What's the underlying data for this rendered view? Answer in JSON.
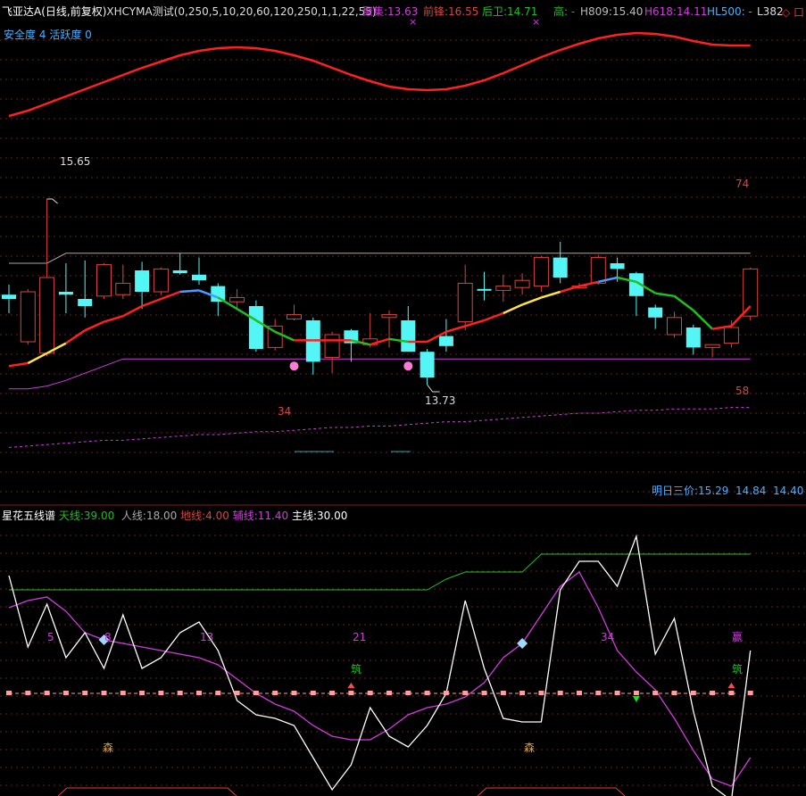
{
  "colors": {
    "background": "#000000",
    "up": "#e0413a",
    "down": "#54f5f5",
    "ma_red": "#ff2020",
    "ma_green": "#1fbf1f",
    "ma_yellow": "#ffe24a",
    "ma_blue": "#4a9cff",
    "magenta": "#d33be0",
    "upper_band": "#a8a8a8",
    "grid": "#6b1f1f",
    "divider": "#8a1a1a",
    "white_line": "#ffffff",
    "tian_line": "#1fbf1f",
    "pink": "#ff9f9f",
    "blue_title": "#4ab0ff"
  },
  "header": {
    "instrument": "飞亚达A(日线,前复权)",
    "indicator": "XHCYMA测试(0,250,5,10,20,60,120,250,1,1,22,55)",
    "juji_label": "聚集:",
    "juji_value": "13.63",
    "qianfeng_label": "前锋:",
    "qianfeng_value": "16.55",
    "houwei_label": "后卫:",
    "houwei_value": "14.71",
    "gao_label": "高: -",
    "h809_label": "H809:",
    "h809_value": "15.40",
    "h618_label": "H618:",
    "h618_value": "14.11",
    "hl500_label": "HL500: -",
    "l382_label": "L382",
    "marker": "×",
    "icons": "◇ 口"
  },
  "safety": {
    "anquan_label": "安全度",
    "anquan_value": "4",
    "huoyue_label": "活跃度",
    "huoyue_value": "0"
  },
  "main_labels": {
    "high_price": "15.65",
    "low_price": "13.73",
    "label_74": "74",
    "label_58": "58",
    "label_34": "34"
  },
  "tomorrow": {
    "label": "明日三价:",
    "p1": "15.29",
    "p2": "14.84",
    "p3": "14.40"
  },
  "sub_header": {
    "title": "星花五线谱",
    "tian_label": "天线:",
    "tian_value": "39.00",
    "ren_label": "人线:",
    "ren_value": "18.00",
    "di_label": "地线:",
    "di_value": "4.00",
    "fu_label": "辅线:",
    "fu_value": "11.40",
    "zhu_label": "主线:",
    "zhu_value": "30.00"
  },
  "sub_labels": {
    "n5": "5",
    "n8": "8",
    "n13": "13",
    "n21": "21",
    "n34": "34",
    "ying": "赢",
    "zhu1": "筑",
    "zhu2": "筑",
    "sen1": "森",
    "sen2": "森"
  },
  "candles": [
    {
      "o": 14.98,
      "c": 14.95,
      "h": 15.05,
      "l": 14.85
    },
    {
      "o": 14.65,
      "c": 15.0,
      "h": 15.02,
      "l": 14.63
    },
    {
      "o": 14.57,
      "c": 15.1,
      "h": 15.65,
      "l": 14.55
    },
    {
      "o": 15.0,
      "c": 14.98,
      "h": 15.2,
      "l": 14.85
    },
    {
      "o": 14.95,
      "c": 14.9,
      "h": 15.22,
      "l": 14.82
    },
    {
      "o": 14.97,
      "c": 15.19,
      "h": 15.2,
      "l": 14.95
    },
    {
      "o": 14.98,
      "c": 15.06,
      "h": 15.19,
      "l": 14.95
    },
    {
      "o": 15.15,
      "c": 15.0,
      "h": 15.21,
      "l": 14.88
    },
    {
      "o": 15.0,
      "c": 15.16,
      "h": 15.17,
      "l": 14.98
    },
    {
      "o": 15.15,
      "c": 15.13,
      "h": 15.27,
      "l": 15.12
    },
    {
      "o": 15.12,
      "c": 15.08,
      "h": 15.24,
      "l": 15.05
    },
    {
      "o": 15.04,
      "c": 14.93,
      "h": 15.06,
      "l": 14.83
    },
    {
      "o": 14.93,
      "c": 14.96,
      "h": 15.02,
      "l": 14.88
    },
    {
      "o": 14.9,
      "c": 14.6,
      "h": 14.94,
      "l": 14.58
    },
    {
      "o": 14.61,
      "c": 14.76,
      "h": 14.81,
      "l": 14.59
    },
    {
      "o": 14.81,
      "c": 14.84,
      "h": 14.91,
      "l": 14.8
    },
    {
      "o": 14.8,
      "c": 14.51,
      "h": 14.82,
      "l": 14.42
    },
    {
      "o": 14.54,
      "c": 14.7,
      "h": 14.72,
      "l": 14.43
    },
    {
      "o": 14.73,
      "c": 14.64,
      "h": 14.74,
      "l": 14.51
    },
    {
      "o": 14.63,
      "c": 14.67,
      "h": 14.85,
      "l": 14.61
    },
    {
      "o": 14.82,
      "c": 14.84,
      "h": 14.87,
      "l": 14.61
    },
    {
      "o": 14.8,
      "c": 14.58,
      "h": 14.9,
      "l": 14.58
    },
    {
      "o": 14.58,
      "c": 14.4,
      "h": 14.6,
      "l": 14.35
    },
    {
      "o": 14.69,
      "c": 14.62,
      "h": 14.81,
      "l": 14.58
    },
    {
      "o": 14.79,
      "c": 15.06,
      "h": 15.19,
      "l": 14.73
    },
    {
      "o": 15.02,
      "c": 15.01,
      "h": 15.14,
      "l": 14.94
    },
    {
      "o": 15.01,
      "c": 15.04,
      "h": 15.12,
      "l": 14.93
    },
    {
      "o": 15.03,
      "c": 15.08,
      "h": 15.13,
      "l": 14.98
    },
    {
      "o": 15.04,
      "c": 15.24,
      "h": 15.25,
      "l": 15.0
    },
    {
      "o": 15.24,
      "c": 15.1,
      "h": 15.35,
      "l": 15.06
    },
    {
      "o": 15.04,
      "c": 15.04,
      "h": 15.06,
      "l": 15.02
    },
    {
      "o": 15.06,
      "c": 15.24,
      "h": 15.26,
      "l": 15.05
    },
    {
      "o": 15.2,
      "c": 15.16,
      "h": 15.24,
      "l": 15.07
    },
    {
      "o": 15.13,
      "c": 14.97,
      "h": 15.14,
      "l": 14.83
    },
    {
      "o": 14.89,
      "c": 14.82,
      "h": 14.91,
      "l": 14.74
    },
    {
      "o": 14.7,
      "c": 14.82,
      "h": 14.86,
      "l": 14.68
    },
    {
      "o": 14.75,
      "c": 14.61,
      "h": 14.77,
      "l": 14.56
    },
    {
      "o": 14.61,
      "c": 14.63,
      "h": 14.63,
      "l": 14.54
    },
    {
      "o": 14.64,
      "c": 14.75,
      "h": 14.8,
      "l": 14.61
    },
    {
      "o": 14.83,
      "c": 15.16,
      "h": 15.17,
      "l": 14.8
    }
  ],
  "chart_data": {
    "type": "line",
    "ma": [
      14.48,
      14.5,
      14.57,
      14.64,
      14.73,
      14.79,
      14.83,
      14.9,
      14.95,
      15.0,
      15.01,
      14.96,
      14.88,
      14.8,
      14.72,
      14.66,
      14.66,
      14.66,
      14.66,
      14.63,
      14.67,
      14.65,
      14.65,
      14.72,
      14.76,
      14.8,
      14.85,
      14.91,
      14.96,
      15.0,
      15.04,
      15.07,
      15.1,
      15.07,
      14.99,
      14.97,
      14.87,
      14.74,
      14.76,
      14.9
    ],
    "upper_band": [
      15.2,
      15.2,
      15.2,
      15.27,
      15.27,
      15.27,
      15.27,
      15.27,
      15.27,
      15.27,
      15.27,
      15.27,
      15.27,
      15.27,
      15.27,
      15.27,
      15.27,
      15.27,
      15.27,
      15.27,
      15.27,
      15.27,
      15.27,
      15.27,
      15.27,
      15.27,
      15.27,
      15.27,
      15.27,
      15.27,
      15.27,
      15.27,
      15.27,
      15.27,
      15.27,
      15.27,
      15.27,
      15.27,
      15.27,
      15.27
    ],
    "lower_band": [
      14.32,
      14.32,
      14.34,
      14.38,
      14.43,
      14.48,
      14.53,
      14.53,
      14.53,
      14.53,
      14.53,
      14.53,
      14.53,
      14.53,
      14.53,
      14.53,
      14.53,
      14.53,
      14.53,
      14.53,
      14.53,
      14.53,
      14.53,
      14.53,
      14.53,
      14.53,
      14.53,
      14.53,
      14.53,
      14.53,
      14.53,
      14.53,
      14.53,
      14.53,
      14.53,
      14.53,
      14.53,
      14.53,
      14.53,
      14.53
    ],
    "long_ma": [
      13.91,
      13.92,
      13.93,
      13.94,
      13.95,
      13.96,
      13.96,
      13.97,
      13.98,
      13.99,
      14.0,
      14.0,
      14.01,
      14.02,
      14.02,
      14.03,
      14.04,
      14.05,
      14.05,
      14.06,
      14.06,
      14.07,
      14.08,
      14.09,
      14.09,
      14.1,
      14.11,
      14.12,
      14.13,
      14.14,
      14.15,
      14.15,
      14.16,
      14.17,
      14.17,
      14.18,
      14.18,
      14.18,
      14.19,
      14.19
    ],
    "top_curve": [
      16.2,
      16.26,
      16.34,
      16.42,
      16.5,
      16.58,
      16.66,
      16.74,
      16.81,
      16.88,
      16.93,
      16.96,
      16.97,
      16.96,
      16.93,
      16.88,
      16.82,
      16.74,
      16.66,
      16.59,
      16.53,
      16.5,
      16.49,
      16.5,
      16.54,
      16.6,
      16.68,
      16.77,
      16.86,
      16.94,
      17.01,
      17.07,
      17.11,
      17.13,
      17.12,
      17.09,
      17.04,
      17.0,
      16.99,
      16.99
    ],
    "zhu_line": [
      51,
      31,
      43,
      28,
      35,
      25,
      40,
      25,
      28,
      35,
      38,
      30,
      16,
      12,
      11,
      9,
      0,
      -9,
      -2,
      14,
      6,
      3,
      9,
      18,
      44,
      25,
      11,
      10,
      10,
      47,
      55,
      55,
      48,
      62,
      29,
      39,
      13,
      -8,
      -12,
      30
    ],
    "fu_line": [
      42,
      44,
      45,
      41,
      35,
      33,
      32,
      31,
      30,
      29,
      28,
      26,
      22,
      18,
      15,
      13,
      9,
      6,
      5,
      5,
      8,
      12,
      14,
      15,
      17,
      21,
      28,
      32,
      40,
      48,
      52,
      42,
      30,
      24,
      19,
      11,
      2,
      -6,
      -8,
      0
    ],
    "tian_line": [
      47,
      47,
      47,
      47,
      47,
      47,
      47,
      47,
      47,
      47,
      47,
      47,
      47,
      47,
      47,
      47,
      47,
      47,
      47,
      47,
      47,
      47,
      47,
      50,
      52,
      52,
      52,
      52,
      57,
      57,
      57,
      57,
      57,
      57,
      57,
      57,
      57,
      57,
      57,
      57
    ],
    "zero_level": 18
  }
}
